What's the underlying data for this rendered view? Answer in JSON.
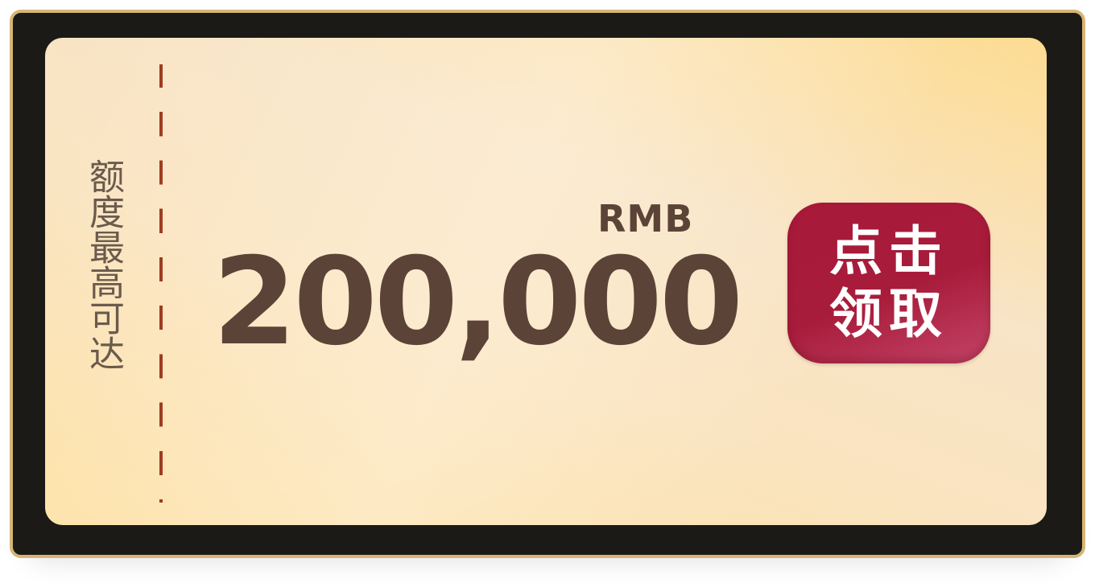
{
  "ticket": {
    "side_label": "额度最高可达",
    "unit": "RMB",
    "amount": "200,000",
    "button": {
      "line1": "点击",
      "line2": "领取"
    }
  },
  "colors": {
    "frame": "#1b1a17",
    "frame_border": "#d8b576",
    "amount_text": "#5c4337",
    "divider": "#9e3d22",
    "button_bg": "#a81c3b",
    "button_text": "#ffffff"
  }
}
